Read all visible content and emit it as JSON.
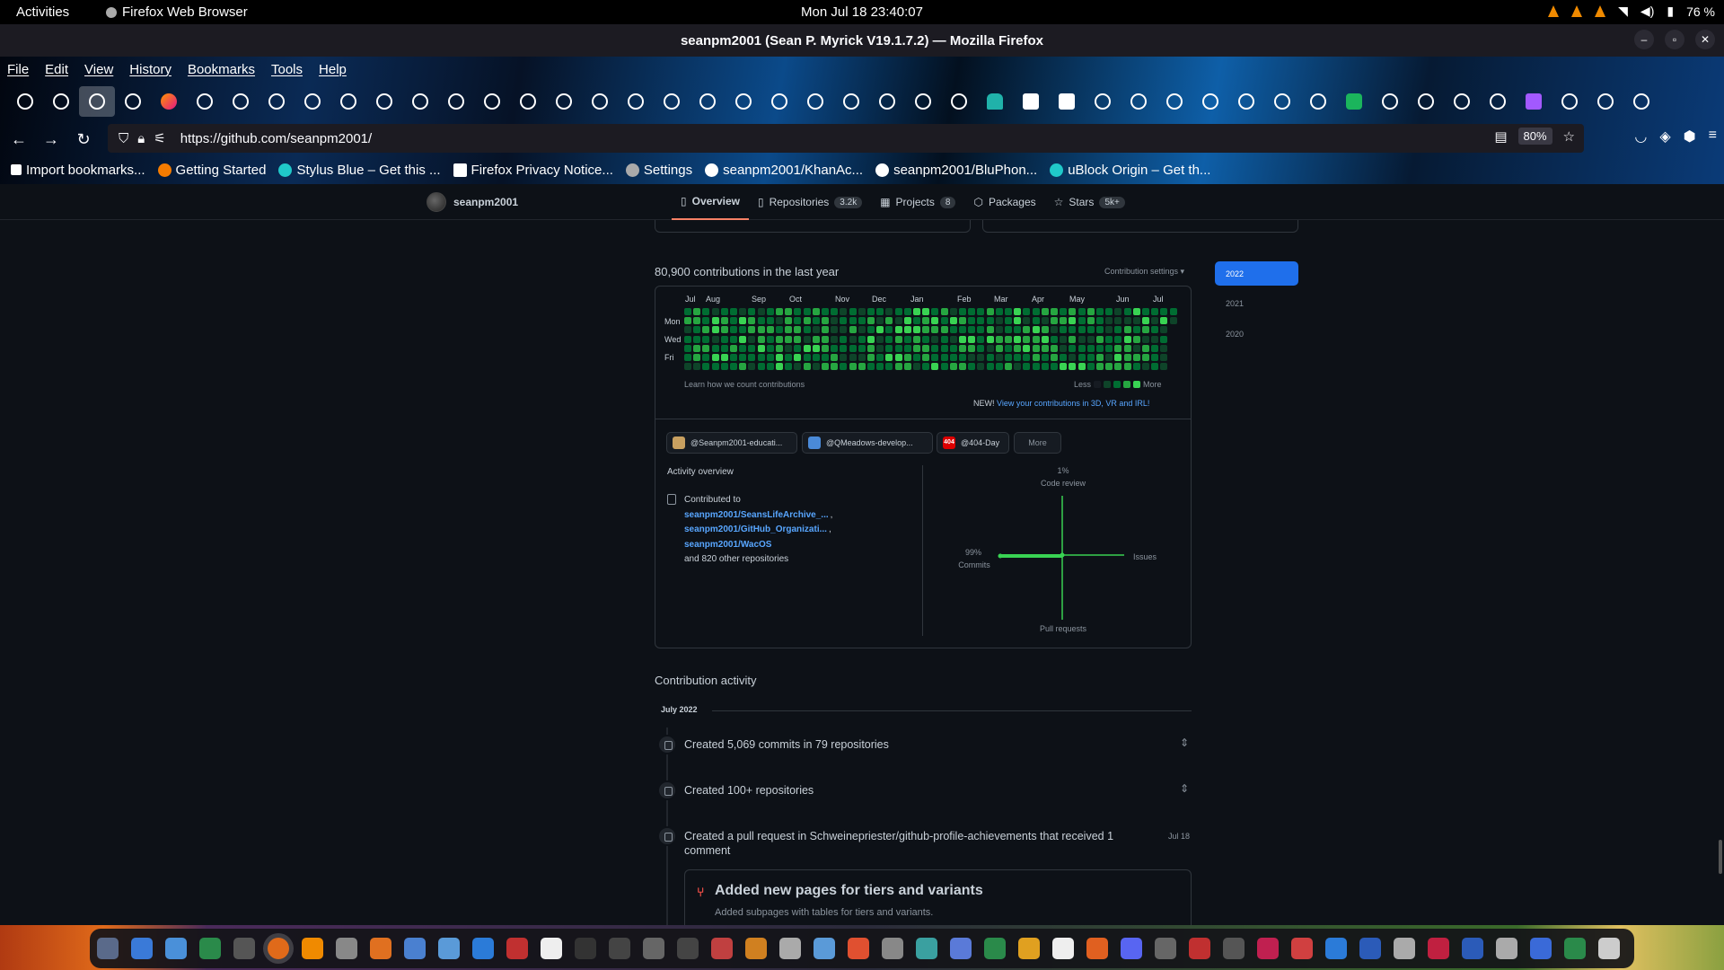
{
  "system": {
    "activities": "Activities",
    "app_name": "Firefox Web Browser",
    "clock": "Mon Jul 18  23:40:07",
    "battery": "76 %"
  },
  "window": {
    "title": "seanpm2001 (Sean P. Myrick V19.1.7.2) — Mozilla Firefox"
  },
  "menu": [
    "File",
    "Edit",
    "View",
    "History",
    "Bookmarks",
    "Tools",
    "Help"
  ],
  "toolbar": {
    "url": "https://github.com/seanpm2001/",
    "zoom": "80%"
  },
  "bookmarks": [
    "Import bookmarks...",
    "Getting Started",
    "Stylus Blue – Get this ...",
    "Firefox Privacy Notice...",
    "Settings",
    "seanpm2001/KhanAc...",
    "seanpm2001/BluPhon...",
    "uBlock Origin – Get th..."
  ],
  "profile_nav": {
    "username": "seanpm2001",
    "tabs": [
      {
        "label": "Overview",
        "count": ""
      },
      {
        "label": "Repositories",
        "count": "3.2k"
      },
      {
        "label": "Projects",
        "count": "8"
      },
      {
        "label": "Packages",
        "count": ""
      },
      {
        "label": "Stars",
        "count": "5k+"
      }
    ]
  },
  "contributions": {
    "title": "80,900 contributions in the last year",
    "settings": "Contribution settings ▾",
    "years": [
      "2022",
      "2021",
      "2020"
    ],
    "months": [
      "Jul",
      "Aug",
      "Sep",
      "Oct",
      "Nov",
      "Dec",
      "Jan",
      "Feb",
      "Mar",
      "Apr",
      "May",
      "Jun",
      "Jul"
    ],
    "days": [
      "Mon",
      "Wed",
      "Fri"
    ],
    "learn": "Learn how we count contributions",
    "less": "Less",
    "more": "More",
    "new_prefix": "NEW!",
    "new_link": "View your contributions in 3D, VR and IRL!"
  },
  "orgs": [
    {
      "label": "@Seanpm2001-educati..."
    },
    {
      "label": "@QMeadows-develop..."
    },
    {
      "label": "@404-Day",
      "badge": "404"
    },
    {
      "label": "More"
    }
  ],
  "activity_overview": {
    "title": "Activity overview",
    "contributed_to": "Contributed to",
    "repos": [
      "seanpm2001/SeansLifeArchive_...",
      "seanpm2001/GitHub_Organizati...",
      "seanpm2001/WacOS"
    ],
    "separators": [
      ",",
      ","
    ],
    "others": "and 820 other repositories",
    "code_review_pct": "1%",
    "code_review": "Code review",
    "commits_pct": "99%",
    "commits": "Commits",
    "issues": "Issues",
    "pull_requests": "Pull requests"
  },
  "contribution_activity": {
    "title": "Contribution activity",
    "month": "July 2022",
    "items": [
      {
        "text": "Created 5,069 commits in 79 repositories",
        "date": ""
      },
      {
        "text": "Created 100+ repositories",
        "date": ""
      },
      {
        "text": "Created a pull request in Schweinepriester/github-profile-achievements that received 1 comment",
        "date": "Jul 18"
      }
    ],
    "pr_title": "Added new pages for tiers and variants",
    "pr_desc": "Added subpages with tables for tiers and variants."
  },
  "colors": {
    "accent_blue": "#1f6feb",
    "link": "#58a6ff",
    "green_levels": [
      "#161b22",
      "#0e4429",
      "#006d32",
      "#26a641",
      "#39d353"
    ]
  }
}
